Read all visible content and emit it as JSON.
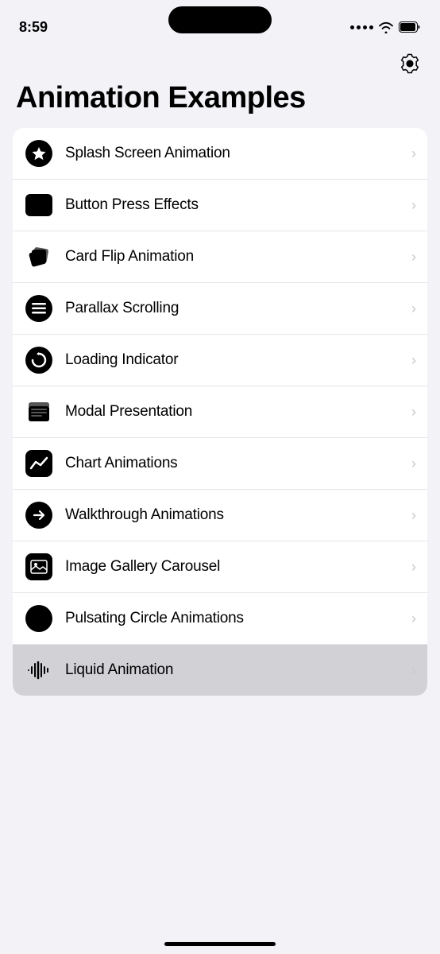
{
  "statusBar": {
    "time": "8:59"
  },
  "header": {
    "title": "Animation Examples",
    "settings_label": "Settings"
  },
  "listItems": [
    {
      "id": "splash",
      "label": "Splash Screen Animation",
      "icon": "star-icon",
      "highlighted": false
    },
    {
      "id": "button-press",
      "label": "Button Press Effects",
      "icon": "button-icon",
      "highlighted": false
    },
    {
      "id": "card-flip",
      "label": "Card Flip Animation",
      "icon": "cube-icon",
      "highlighted": false
    },
    {
      "id": "parallax",
      "label": "Parallax Scrolling",
      "icon": "lines-icon",
      "highlighted": false
    },
    {
      "id": "loading",
      "label": "Loading Indicator",
      "icon": "refresh-icon",
      "highlighted": false
    },
    {
      "id": "modal",
      "label": "Modal Presentation",
      "icon": "stack-icon",
      "highlighted": false
    },
    {
      "id": "chart",
      "label": "Chart Animations",
      "icon": "chart-icon",
      "highlighted": false
    },
    {
      "id": "walkthrough",
      "label": "Walkthrough Animations",
      "icon": "arrow-circle-icon",
      "highlighted": false
    },
    {
      "id": "gallery",
      "label": "Image Gallery Carousel",
      "icon": "image-icon",
      "highlighted": false
    },
    {
      "id": "pulsating",
      "label": "Pulsating Circle Animations",
      "icon": "circle-icon",
      "highlighted": false
    },
    {
      "id": "liquid",
      "label": "Liquid Animation",
      "icon": "waveform-icon",
      "highlighted": true
    }
  ],
  "chevron": "›"
}
